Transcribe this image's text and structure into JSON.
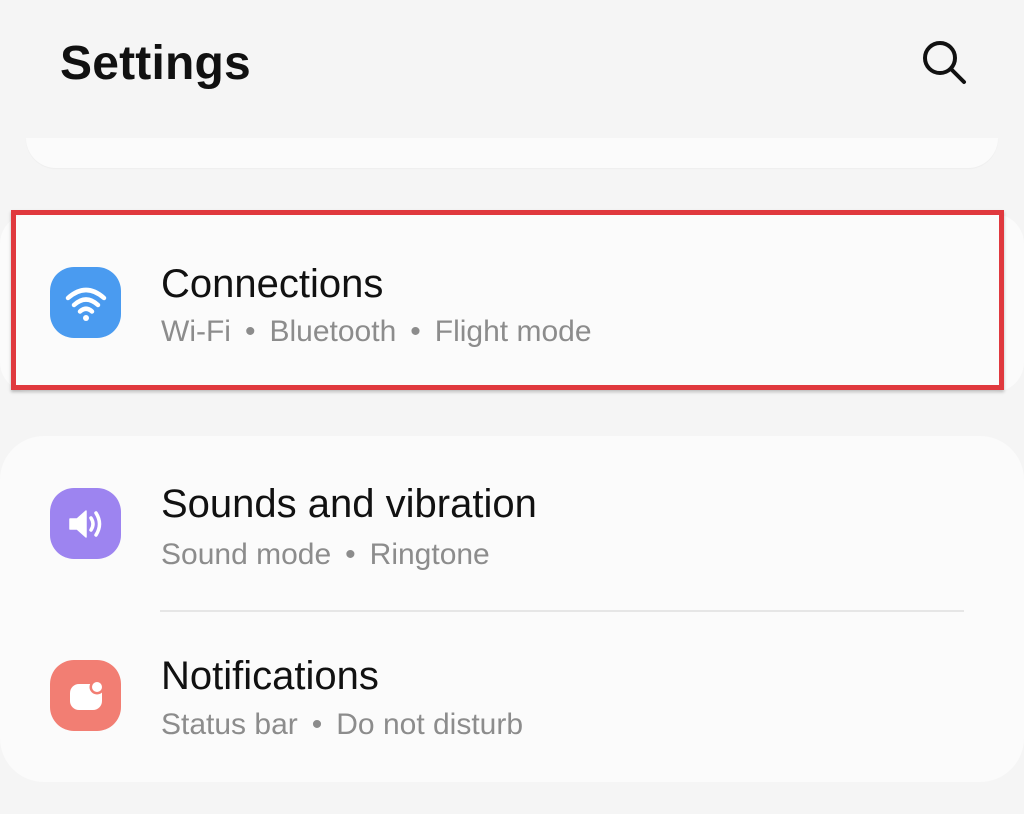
{
  "header": {
    "title": "Settings",
    "search_icon": "search-icon"
  },
  "colors": {
    "highlight": "#e0393e",
    "connections_icon_bg": "#4a9bf0",
    "sounds_icon_bg": "#9d84f0",
    "notifications_icon_bg": "#f27e73"
  },
  "items": [
    {
      "title": "Connections",
      "icon": "wifi-icon",
      "subtitle": [
        "Wi-Fi",
        "Bluetooth",
        "Flight mode"
      ],
      "highlighted": true
    },
    {
      "title": "Sounds and vibration",
      "icon": "volume-icon",
      "subtitle": [
        "Sound mode",
        "Ringtone"
      ]
    },
    {
      "title": "Notifications",
      "icon": "notification-badge-icon",
      "subtitle": [
        "Status bar",
        "Do not disturb"
      ]
    }
  ],
  "separator": "•"
}
